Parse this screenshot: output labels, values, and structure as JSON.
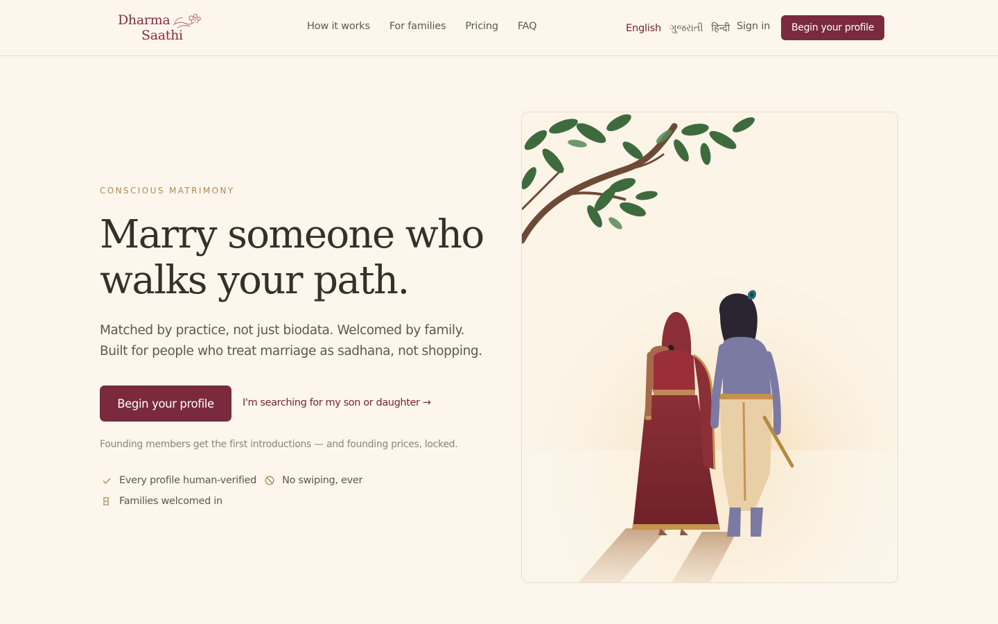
{
  "brand": {
    "line1": "Dharma",
    "line2": "Saathi"
  },
  "nav": {
    "items": [
      "How it works",
      "For families",
      "Pricing",
      "FAQ"
    ]
  },
  "languages": {
    "items": [
      "English",
      "ગુજરાતી",
      "हिन्दी"
    ],
    "active": "English"
  },
  "header": {
    "signin_label": "Sign in",
    "cta_label": "Begin your profile"
  },
  "hero": {
    "eyebrow": "CONSCIOUS MATRIMONY",
    "headline_line1": "Marry someone who",
    "headline_line2": "walks your path.",
    "subtext": "Matched by practice, not just biodata. Welcomed by family. Built for people who treat marriage as sadhana, not shopping.",
    "cta_primary": "Begin your profile",
    "cta_secondary": "I'm searching for my son or daughter →",
    "founding_note": "Founding members get the first introductions — and founding prices, locked.",
    "features": [
      {
        "icon": "check-icon",
        "label": "Every profile human-verified"
      },
      {
        "icon": "no-symbol-icon",
        "label": "No swiping, ever"
      },
      {
        "icon": "family-icon",
        "label": "Families welcomed in"
      }
    ]
  },
  "colors": {
    "background": "#fcf6ec",
    "brand_maroon": "#7a2a3c",
    "accent_gold": "#b08a55",
    "text_dark": "#35302a"
  }
}
